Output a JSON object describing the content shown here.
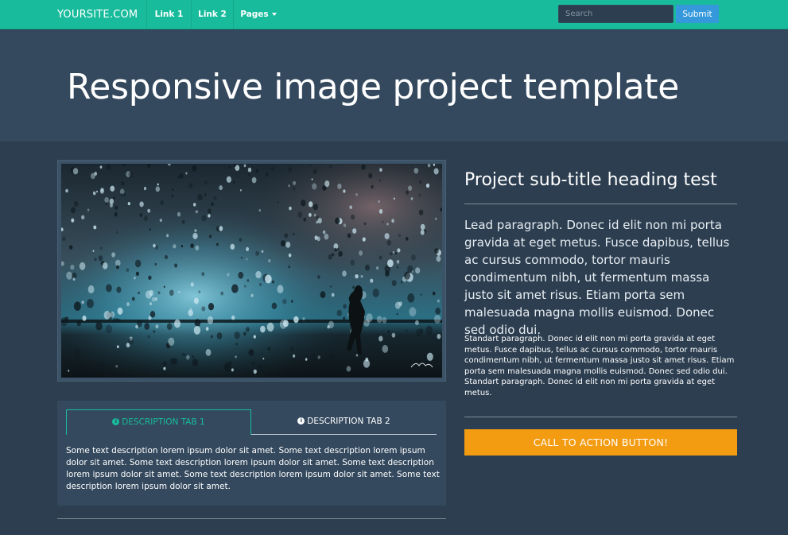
{
  "navbar": {
    "brand": "YOURSITE.COM",
    "links": [
      "Link 1",
      "Link 2",
      "Pages"
    ],
    "search_placeholder": "Search",
    "submit_label": "Submit"
  },
  "hero": {
    "title": "Responsive image project template"
  },
  "tabs": {
    "tab1_label": "DESCRIPTION TAB 1",
    "tab2_label": "DESCRIPTION TAB 2",
    "content": "Some text description lorem ipsum dolor sit amet. Some text description lorem ipsum dolor sit amet. Some text description lorem ipsum dolor sit amet. Some text description lorem ipsum dolor sit amet. Some text description lorem ipsum dolor sit amet. Some text description lorem ipsum dolor sit amet."
  },
  "content": {
    "subtitle": "Project sub-title heading test",
    "lead": "Lead paragraph. Donec id elit non mi porta gravida at eget metus. Fusce dapibus, tellus ac cursus commodo, tortor mauris condimentum nibh, ut fermentum massa justo sit amet risus. Etiam porta sem malesuada magna mollis euismod. Donec sed odio dui.",
    "paragraph": "Standart paragraph. Donec id elit non mi porta gravida at eget metus. Fusce dapibus, tellus ac cursus commodo, tortor mauris condimentum nibh, ut fermentum massa justo sit amet risus. Etiam porta sem malesuada magna mollis euismod. Donec sed odio dui. Standart paragraph. Donec id elit non mi porta gravida at eget metus.",
    "cta_label": "CALL TO ACTION BUTTON!"
  },
  "colors": {
    "navbar": "#18bc9c",
    "hero": "#34495e",
    "background": "#2c3e50",
    "submit": "#3498db",
    "cta": "#f39c12"
  },
  "icons": {
    "tab_icon": "info-circle-icon",
    "dropdown_icon": "caret-down-icon"
  }
}
